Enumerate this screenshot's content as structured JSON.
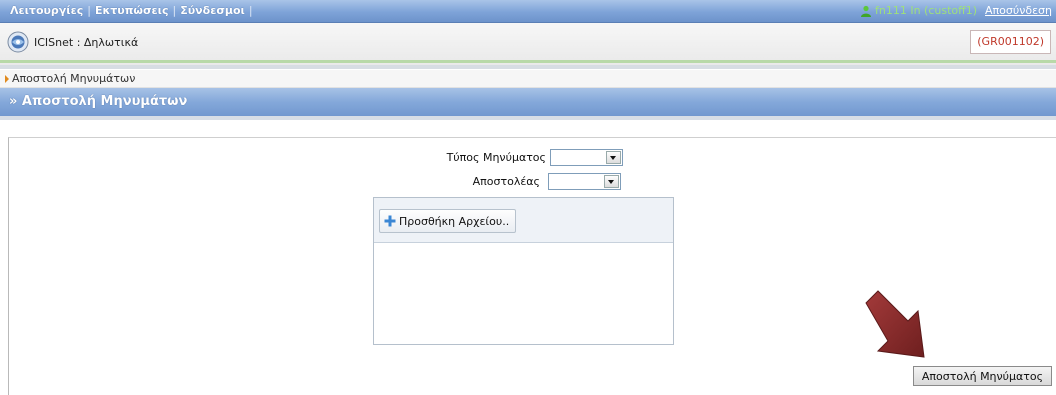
{
  "topbar": {
    "menu": [
      "Λειτουργίες",
      "Εκτυπώσεις",
      "Σύνδεσμοι"
    ],
    "user_text": "fn111 In (custoff1)",
    "logout_label": "Αποσύνδεση"
  },
  "appbar": {
    "title": "ICISnet : Δηλωτικά",
    "code": "(GR001102)"
  },
  "breadcrumb": {
    "label": "Αποστολή Μηνυμάτων"
  },
  "section": {
    "title": "» Αποστολή Μηνυμάτων"
  },
  "form": {
    "message_type_label": "Τύπος Μηνύματος",
    "message_type_value": "",
    "sender_label": "Αποστολέας",
    "sender_value": ""
  },
  "upload": {
    "add_file_label": "Προσθήκη Αρχείου.."
  },
  "actions": {
    "send_label": "Αποστολή Μηνύματος"
  },
  "colors": {
    "accent_blue": "#7ea3d8",
    "code_red": "#c0392b",
    "arrow_red": "#8b2a2a"
  },
  "icons": [
    "user-icon",
    "icisnet-logo-icon",
    "breadcrumb-arrow-icon",
    "plus-icon",
    "dropdown-arrow-icon",
    "red-pointer-arrow"
  ]
}
